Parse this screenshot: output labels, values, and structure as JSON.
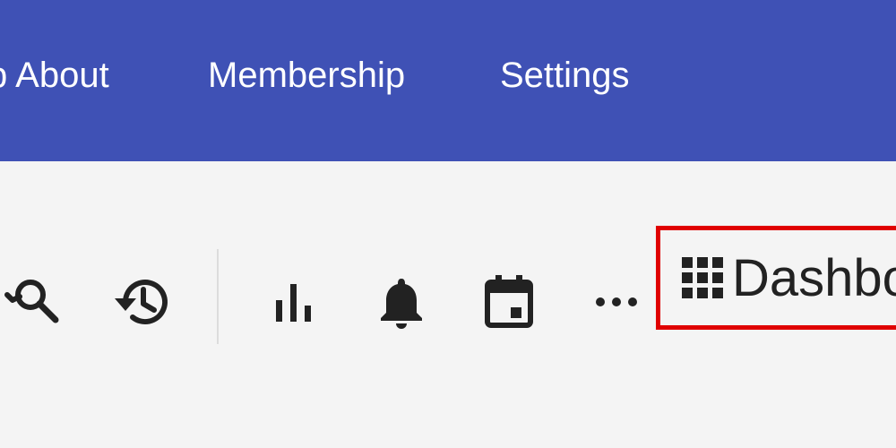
{
  "nav": {
    "items": [
      {
        "label": "p About"
      },
      {
        "label": "Membership"
      },
      {
        "label": "Settings"
      }
    ]
  },
  "toolbar": {
    "icons": [
      "search-icon",
      "history-icon",
      "bar-chart-icon",
      "bell-icon",
      "calendar-icon",
      "more-horizontal-icon"
    ],
    "dashboard": {
      "icon": "grid-icon",
      "label": "Dashbo"
    }
  },
  "colors": {
    "nav_bg": "#3f51b5",
    "page_bg": "#f4f4f4",
    "highlight": "#e00000",
    "icon": "#222222"
  }
}
